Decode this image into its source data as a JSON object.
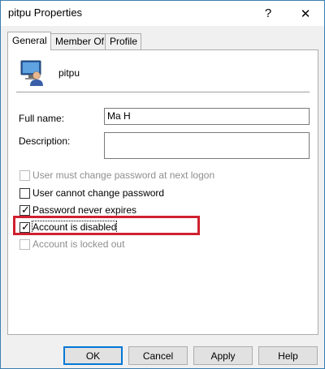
{
  "window": {
    "title": "pitpu Properties",
    "help_glyph": "?",
    "close_glyph": "✕"
  },
  "tabs": [
    {
      "label": "General",
      "active": true
    },
    {
      "label": "Member Of",
      "active": false
    },
    {
      "label": "Profile",
      "active": false
    }
  ],
  "user": {
    "name": "pitpu",
    "icon": "user-computer-icon"
  },
  "fields": {
    "full_name_label": "Full name:",
    "full_name_value": "Ma H",
    "description_label": "Description:",
    "description_value": ""
  },
  "checkboxes": [
    {
      "label": "User must change password at next logon",
      "checked": false,
      "enabled": false
    },
    {
      "label": "User cannot change password",
      "checked": false,
      "enabled": true
    },
    {
      "label": "Password never expires",
      "checked": true,
      "enabled": true
    },
    {
      "label": "Account is disabled",
      "checked": true,
      "enabled": true,
      "focused": true
    },
    {
      "label": "Account is locked out",
      "checked": false,
      "enabled": false
    }
  ],
  "buttons": {
    "ok": "OK",
    "cancel": "Cancel",
    "apply": "Apply",
    "help": "Help"
  },
  "colors": {
    "highlight_box": "#d0202f",
    "default_button_border": "#0078d7"
  }
}
